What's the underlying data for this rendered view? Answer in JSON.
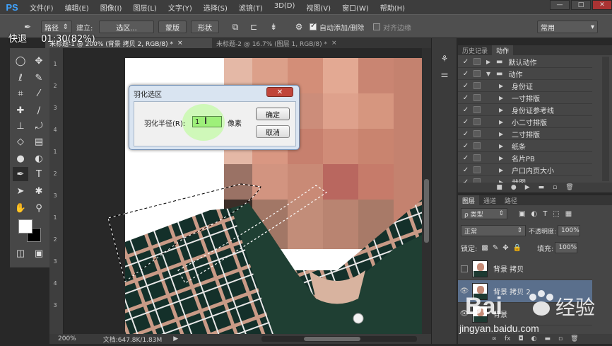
{
  "app": {
    "logo": "PS"
  },
  "menu": [
    "文件(F)",
    "编辑(E)",
    "图像(I)",
    "图层(L)",
    "文字(Y)",
    "选择(S)",
    "滤镜(T)",
    "3D(D)",
    "视图(V)",
    "窗口(W)",
    "帮助(H)"
  ],
  "window_controls": {
    "minimize": "—",
    "maximize": "□",
    "close": "✕"
  },
  "options_bar": {
    "path_mode": "路径",
    "build_label": "建立:",
    "selection_btn": "选区...",
    "mask_btn": "蒙版",
    "shape_btn": "形状",
    "auto_add_delete": "自动添加/删除",
    "align_edges": "对齐边缘",
    "workspace": "常用"
  },
  "overlay": {
    "speed_label": "快退",
    "time": "01:30(82%)"
  },
  "tabs": {
    "active": "未标题-1 @ 200% (背景 拷贝 2, RGB/8) *",
    "inactive": "未标题-2 @ 16.7% (图层 1, RGB/8) *"
  },
  "ruler_numbers": [
    "1",
    "2",
    "3",
    "4",
    "1",
    "2",
    "3",
    "1",
    "2",
    "3",
    "4",
    "3"
  ],
  "status_bar": {
    "zoom": "200%",
    "doc": "文档:647.8K/1.83M"
  },
  "dialog": {
    "title": "羽化选区",
    "close": "✕",
    "radius_label": "羽化半径(R):",
    "radius_value": "1",
    "unit": "像素",
    "ok": "确定",
    "cancel": "取消"
  },
  "history_panel": {
    "tabs": [
      "历史记录",
      "动作"
    ],
    "rows": [
      {
        "label": "默认动作",
        "type": "folder",
        "arrow": "▶"
      },
      {
        "label": "动作",
        "type": "folder",
        "arrow": "▼"
      },
      {
        "label": "身份证",
        "type": "action",
        "arrow": "▶"
      },
      {
        "label": "一寸排版",
        "type": "action",
        "arrow": "▶"
      },
      {
        "label": "身份证参考线",
        "type": "action",
        "arrow": "▶"
      },
      {
        "label": "小二寸排版",
        "type": "action",
        "arrow": "▶"
      },
      {
        "label": "二寸排版",
        "type": "action",
        "arrow": "▶"
      },
      {
        "label": "纸条",
        "type": "action",
        "arrow": "▶"
      },
      {
        "label": "名片PB",
        "type": "action",
        "arrow": "▶"
      },
      {
        "label": "户口内页大小",
        "type": "action",
        "arrow": "▶"
      },
      {
        "label": "裁图",
        "type": "action",
        "arrow": "▶"
      }
    ]
  },
  "layers_panel": {
    "tabs": [
      "图层",
      "通道",
      "路径"
    ],
    "filter_kind": "ρ 类型",
    "blend_mode": "正常",
    "opacity_label": "不透明度:",
    "opacity_value": "100%",
    "lock_label": "锁定:",
    "fill_label": "填充:",
    "fill_value": "100%",
    "layers": [
      {
        "name": "背景 拷贝",
        "visible": false,
        "selected": false
      },
      {
        "name": "背景 拷贝 2",
        "visible": true,
        "selected": true
      },
      {
        "name": "背景",
        "visible": true,
        "selected": false
      }
    ]
  },
  "watermark": {
    "brand": "Baidu",
    "brand_cn": "经验",
    "url": "jingyan.baidu.com"
  },
  "colors": {
    "foreground": "#ffffff",
    "background": "#000000",
    "accent": "#3fa3ff"
  }
}
